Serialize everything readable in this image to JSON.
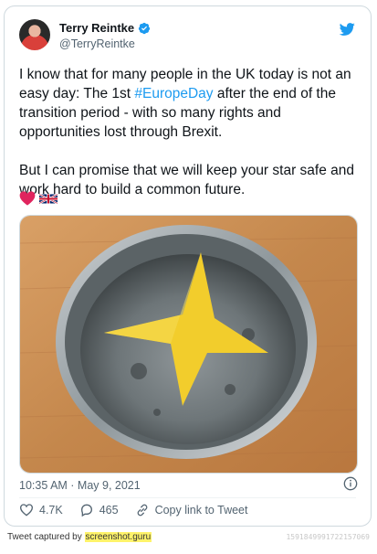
{
  "tweet": {
    "author": {
      "display_name": "Terry Reintke",
      "handle": "@TerryReintke",
      "verified": true
    },
    "text_part1": "I know that for many people in the UK today is not an easy day: The 1st ",
    "hashtag": "#EuropeDay",
    "text_part2": " after the end of the transition period - with so many rights and opportunities lost through Brexit.\n\nBut I can promise that we will keep your star safe and work hard to build a common future.",
    "emojis": [
      "red-heart-icon",
      "uk-flag-icon"
    ],
    "timestamp": "10:35 AM · May 9, 2021",
    "likes": "4.7K",
    "replies": "465",
    "copy_link_label": "Copy link to Tweet"
  },
  "caption": {
    "prefix": "Tweet captured by ",
    "site": "screenshot.guru",
    "watermark": "1591849991722157069"
  },
  "colors": {
    "accent": "#1d9bf0",
    "heart": "#e0245e",
    "star": "#f2cd2c",
    "table_wood": "#c88c52"
  }
}
